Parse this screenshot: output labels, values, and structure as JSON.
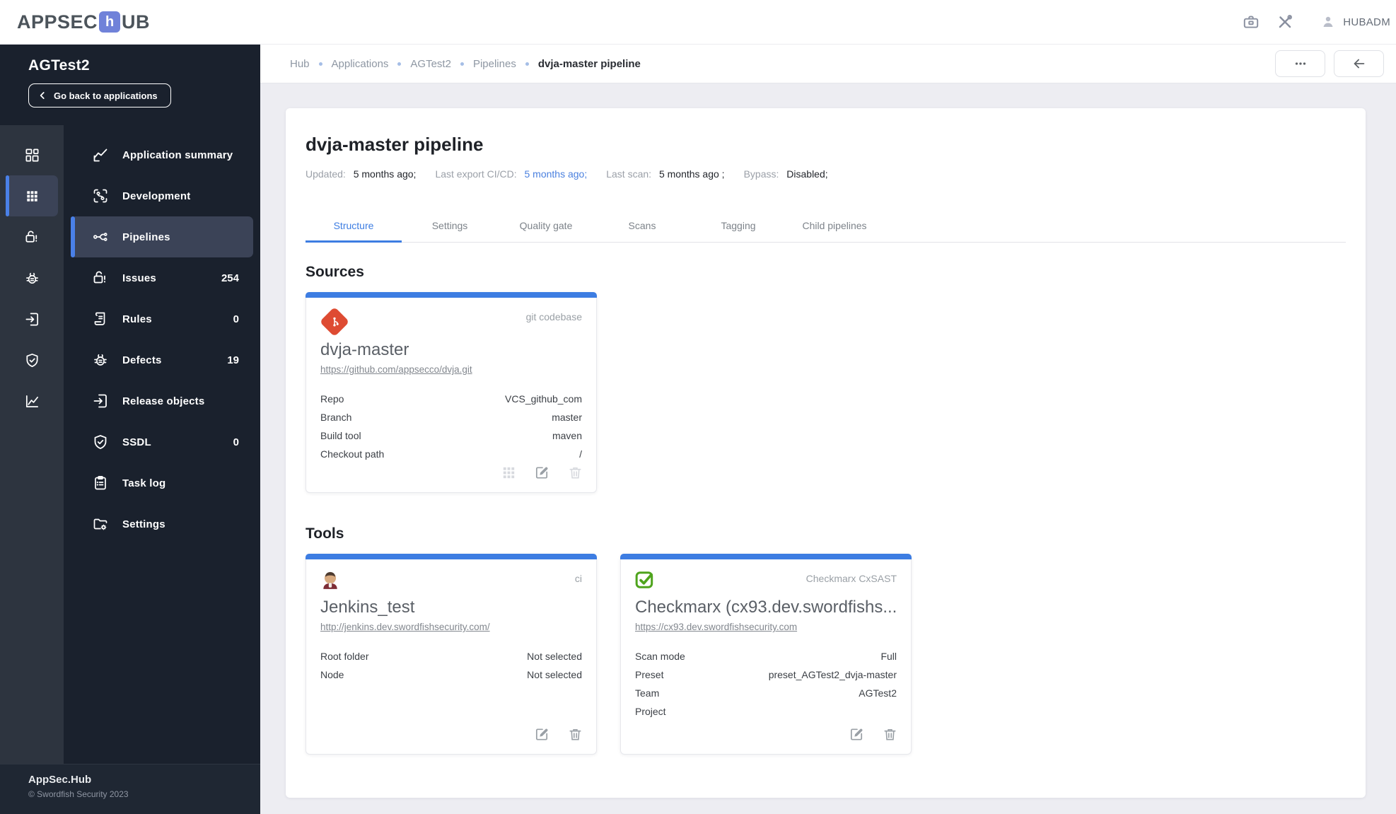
{
  "app": {
    "logo": {
      "prefix": "APPSEC",
      "mid": "h",
      "suffix": "UB"
    },
    "user": "HUBADM"
  },
  "colors": {
    "accent": "#3D7DE2",
    "sidebar_bg": "#1A212D",
    "rail_bg": "#2D343F",
    "active_item_bg": "#3B4357",
    "active_bar": "#4A80E8",
    "git_icon": "#DE4B32",
    "checkmarx_green": "#4FA41D",
    "link": "#4A80DF"
  },
  "sidebar": {
    "app_name": "AGTest2",
    "back_label": "Go back to applications",
    "items": [
      {
        "icon": "chart-line-icon",
        "label": "Application summary"
      },
      {
        "icon": "development-icon",
        "label": "Development"
      },
      {
        "icon": "pipelines-icon",
        "label": "Pipelines",
        "active": true
      },
      {
        "icon": "lock-alert-icon",
        "label": "Issues",
        "badge": "254"
      },
      {
        "icon": "rules-icon",
        "label": "Rules",
        "badge": "0"
      },
      {
        "icon": "bug-icon",
        "label": "Defects",
        "badge": "19"
      },
      {
        "icon": "release-icon",
        "label": "Release objects"
      },
      {
        "icon": "shield-check-icon",
        "label": "SSDL",
        "badge": "0"
      },
      {
        "icon": "tasklog-icon",
        "label": "Task log"
      },
      {
        "icon": "settings-folder-icon",
        "label": "Settings"
      }
    ],
    "footer": {
      "title": "AppSec.Hub",
      "copyright": "© Swordfish Security 2023"
    }
  },
  "breadcrumb": {
    "items": [
      "Hub",
      "Applications",
      "AGTest2",
      "Pipelines"
    ],
    "current": "dvja-master pipeline"
  },
  "page": {
    "title": "dvja-master pipeline",
    "meta": [
      {
        "label": "Updated:",
        "value": "5 months ago;"
      },
      {
        "label": "Last export CI/CD:",
        "value": "5 months ago;"
      },
      {
        "label": "Last scan:",
        "value": "5 months ago ;"
      },
      {
        "label": "Bypass:",
        "value": "Disabled;"
      }
    ],
    "tabs": [
      {
        "label": "Structure",
        "active": true
      },
      {
        "label": "Settings"
      },
      {
        "label": "Quality gate"
      },
      {
        "label": "Scans"
      },
      {
        "label": "Tagging"
      },
      {
        "label": "Child pipelines"
      }
    ]
  },
  "sources": {
    "heading": "Sources",
    "card": {
      "type": "git codebase",
      "title": "dvja-master",
      "url": "https://github.com/appsecco/dvja.git",
      "rows": [
        {
          "label": "Repo",
          "value": "VCS_github_com"
        },
        {
          "label": "Branch",
          "value": "master"
        },
        {
          "label": "Build tool",
          "value": "maven"
        },
        {
          "label": "Checkout path",
          "value": "/"
        }
      ]
    }
  },
  "tools": {
    "heading": "Tools",
    "cards": [
      {
        "type": "ci",
        "title": "Jenkins_test",
        "url": "http://jenkins.dev.swordfishsecurity.com/",
        "rows": [
          {
            "label": "Root folder",
            "value": "Not selected"
          },
          {
            "label": "Node",
            "value": "Not selected"
          }
        ]
      },
      {
        "type": "Checkmarx CxSAST",
        "title": "Checkmarx (cx93.dev.swordfishs...",
        "url": "https://cx93.dev.swordfishsecurity.com",
        "rows": [
          {
            "label": "Scan mode",
            "value": "Full"
          },
          {
            "label": "Preset",
            "value": "preset_AGTest2_dvja-master"
          },
          {
            "label": "Team",
            "value": "AGTest2"
          },
          {
            "label": "Project",
            "value": ""
          }
        ]
      }
    ]
  }
}
